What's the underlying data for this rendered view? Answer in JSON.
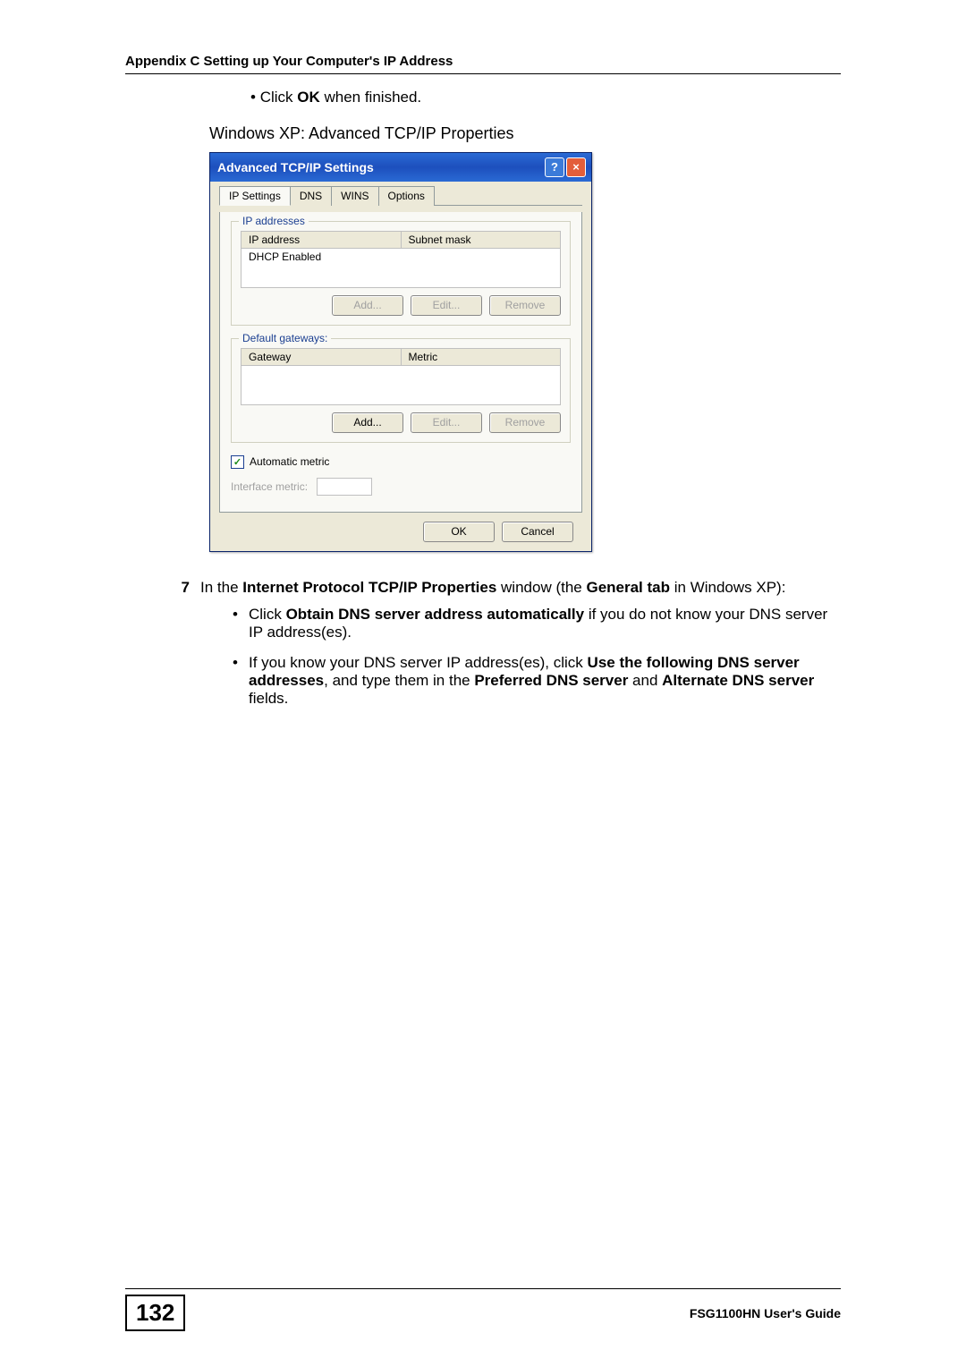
{
  "header": "Appendix C Setting up Your Computer's IP Address",
  "intro_bullet": {
    "pre": "Click ",
    "b": "OK",
    "post": " when finished."
  },
  "figure_caption": "Windows XP: Advanced TCP/IP Properties",
  "dialog": {
    "title": "Advanced TCP/IP Settings",
    "tabs": [
      "IP Settings",
      "DNS",
      "WINS",
      "Options"
    ],
    "group1": {
      "legend": "IP addresses",
      "cols": [
        "IP address",
        "Subnet mask"
      ],
      "row1": "DHCP Enabled",
      "btns": [
        "Add...",
        "Edit...",
        "Remove"
      ]
    },
    "group2": {
      "legend": "Default gateways:",
      "cols": [
        "Gateway",
        "Metric"
      ],
      "btns": [
        "Add...",
        "Edit...",
        "Remove"
      ]
    },
    "auto_metric": "Automatic metric",
    "interface_metric": "Interface metric:",
    "ok": "OK",
    "cancel": "Cancel"
  },
  "step": {
    "num": "7",
    "pre": "In the ",
    "b1": "Internet Protocol TCP/IP Properties",
    "mid": " window (the ",
    "b2": "General tab",
    "post": " in Windows XP):"
  },
  "sub1": {
    "pre": "Click ",
    "b": "Obtain DNS server address automatically",
    "post": " if you do not know your DNS server IP address(es)."
  },
  "sub2": {
    "pre": "If you know your DNS server IP address(es), click ",
    "b1": "Use the following DNS server addresses",
    "mid": ", and type them in the ",
    "b2": "Preferred DNS server",
    "and": " and ",
    "b3": "Alternate DNS server",
    "post": " fields."
  },
  "page_number": "132",
  "footer_right": "FSG1100HN User's Guide"
}
